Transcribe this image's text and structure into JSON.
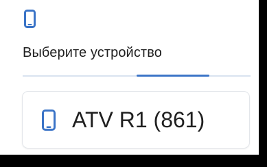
{
  "header": {
    "icon": "smartphone-icon",
    "title": "Выберите устройство"
  },
  "progress": {
    "start_fraction": 0.5,
    "end_fraction": 0.82
  },
  "devices": [
    {
      "icon": "smartphone-icon",
      "name": "ATV R1 (861)"
    }
  ],
  "colors": {
    "accent": "#3b74c7",
    "track": "#d9e3f0",
    "text": "#1f1f1f",
    "background": "#ffffff"
  }
}
